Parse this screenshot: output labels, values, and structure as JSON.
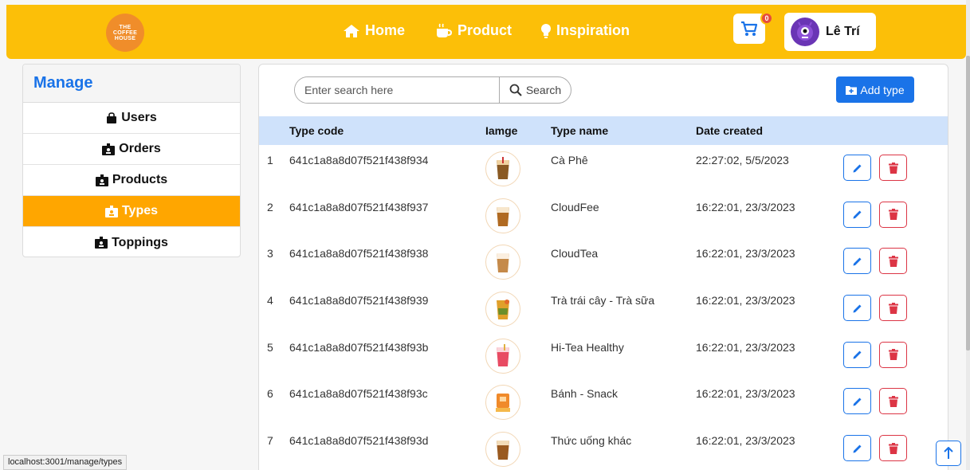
{
  "header": {
    "logo_lines": [
      "THE",
      "COFFEE",
      "HOUSE"
    ],
    "nav": [
      {
        "label": "Home",
        "icon": "home-icon"
      },
      {
        "label": "Product",
        "icon": "coffee-cup-icon"
      },
      {
        "label": "Inspiration",
        "icon": "lightbulb-icon"
      }
    ],
    "cart_count": "0",
    "user_name": "Lê Trí"
  },
  "sidebar": {
    "title": "Manage",
    "items": [
      {
        "label": "Users",
        "icon": "bag-icon"
      },
      {
        "label": "Orders",
        "icon": "id-badge-icon"
      },
      {
        "label": "Products",
        "icon": "id-badge-icon"
      },
      {
        "label": "Types",
        "icon": "id-badge-icon",
        "active": true
      },
      {
        "label": "Toppings",
        "icon": "id-badge-icon"
      }
    ]
  },
  "main": {
    "search": {
      "placeholder": "Enter search here",
      "button_label": "Search"
    },
    "add_button_label": "Add type",
    "columns": [
      "Type code",
      "Iamge",
      "Type name",
      "Date created"
    ],
    "rows": [
      {
        "num": "1",
        "code": "641c1a8a8d07f521f438f934",
        "name": "Cà Phê",
        "date": "22:27:02, 5/5/2023"
      },
      {
        "num": "2",
        "code": "641c1a8a8d07f521f438f937",
        "name": "CloudFee",
        "date": "16:22:01, 23/3/2023"
      },
      {
        "num": "3",
        "code": "641c1a8a8d07f521f438f938",
        "name": "CloudTea",
        "date": "16:22:01, 23/3/2023"
      },
      {
        "num": "4",
        "code": "641c1a8a8d07f521f438f939",
        "name": "Trà trái cây - Trà sữa",
        "date": "16:22:01, 23/3/2023"
      },
      {
        "num": "5",
        "code": "641c1a8a8d07f521f438f93b",
        "name": "Hi-Tea Healthy",
        "date": "16:22:01, 23/3/2023"
      },
      {
        "num": "6",
        "code": "641c1a8a8d07f521f438f93c",
        "name": "Bánh - Snack",
        "date": "16:22:01, 23/3/2023"
      },
      {
        "num": "7",
        "code": "641c1a8a8d07f521f438f93d",
        "name": "Thức uống khác",
        "date": "16:22:01, 23/3/2023"
      }
    ]
  },
  "status_url": "localhost:3001/manage/types",
  "colors": {
    "header": "#fcbf08",
    "accent": "#1a73e8",
    "active": "#ffa600",
    "danger": "#dc3545"
  }
}
